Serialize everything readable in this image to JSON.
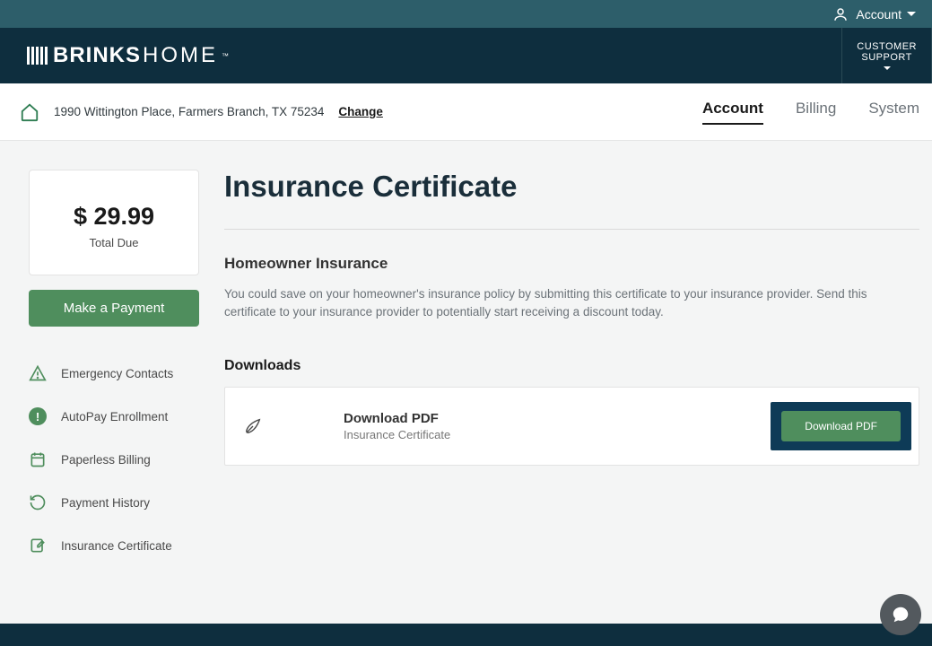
{
  "topbar": {
    "account_label": "Account"
  },
  "header": {
    "logo_bold": "BRINKS",
    "logo_light": "HOME",
    "customer_support_line1": "CUSTOMER",
    "customer_support_line2": "SUPPORT"
  },
  "subheader": {
    "address": "1990 Wittington Place, Farmers Branch, TX 75234",
    "change_label": "Change",
    "tabs": {
      "account": "Account",
      "billing": "Billing",
      "system": "System"
    }
  },
  "sidebar": {
    "balance_amount": "$ 29.99",
    "balance_label": "Total Due",
    "payment_btn": "Make a Payment",
    "nav": {
      "emergency": "Emergency Contacts",
      "autopay": "AutoPay Enrollment",
      "paperless": "Paperless Billing",
      "history": "Payment History",
      "insurance": "Insurance Certificate"
    }
  },
  "content": {
    "page_title": "Insurance Certificate",
    "section_title": "Homeowner Insurance",
    "section_desc": "You could save on your homeowner's insurance policy by submitting this certificate to your insurance provider. Send this certificate to your insurance provider to potentially start receiving a discount today.",
    "downloads_title": "Downloads",
    "download_item": {
      "title": "Download PDF",
      "subtitle": "Insurance Certificate",
      "button": "Download PDF"
    }
  }
}
